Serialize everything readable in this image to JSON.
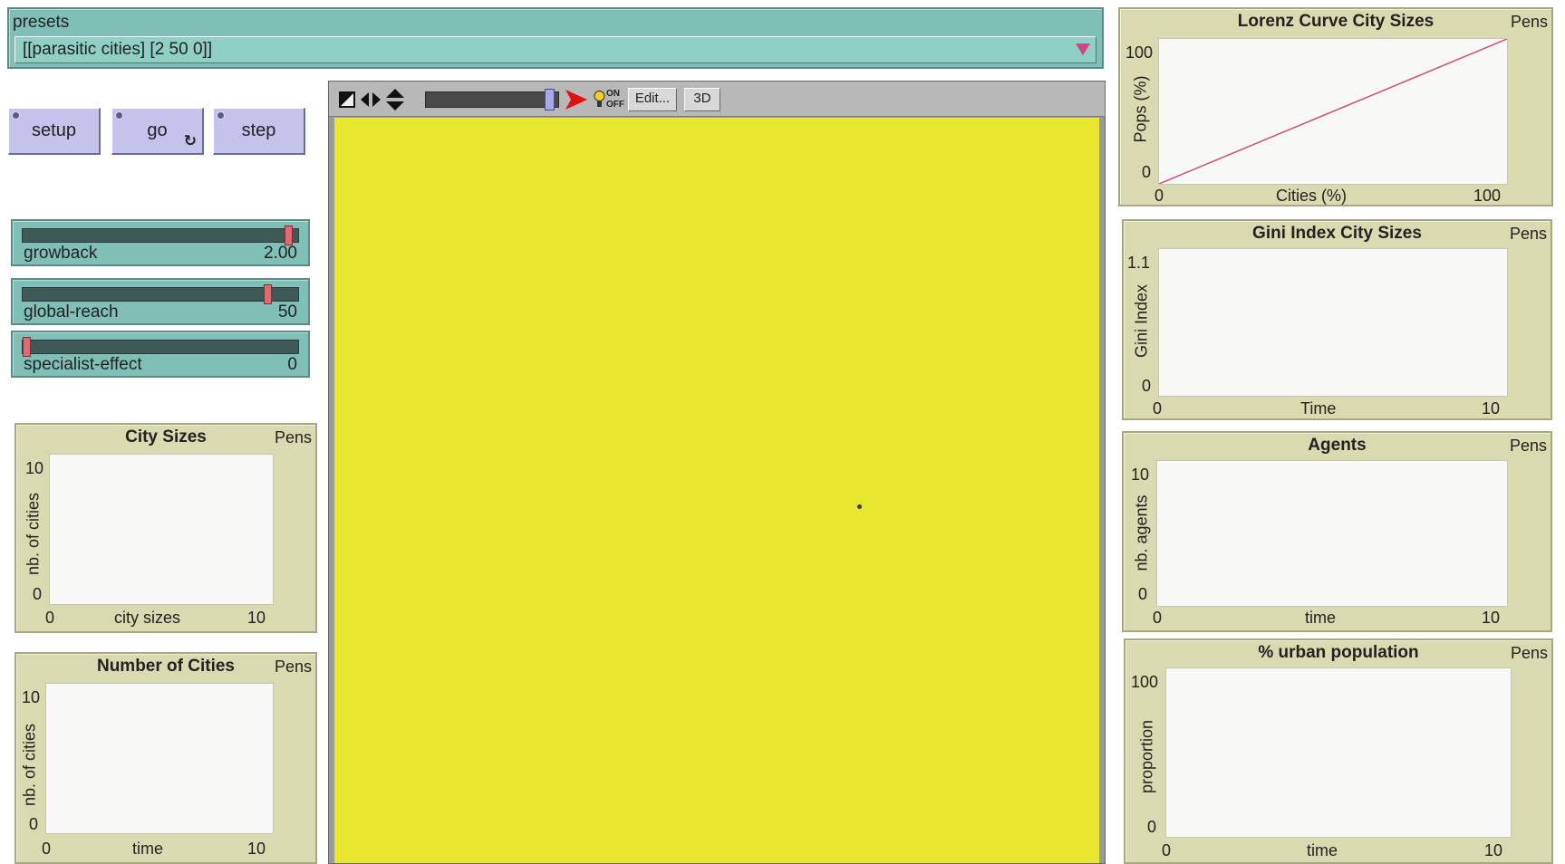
{
  "presets": {
    "label": "presets",
    "selected": "[[parasitic cities] [2 50 0]]"
  },
  "buttons": {
    "setup": "setup",
    "go": "go",
    "step": "step",
    "forever_icon": "forever-icon"
  },
  "sliders": [
    {
      "name": "growback",
      "value": "2.00",
      "level": 0.98
    },
    {
      "name": "global-reach",
      "value": "50",
      "level": 0.9
    },
    {
      "name": "specialist-effect",
      "value": "0",
      "level": 0.0
    }
  ],
  "view_toolbar": {
    "edit_label": "Edit...",
    "three_d_label": "3D",
    "speed_level": 0.97,
    "icons": [
      "size-icon",
      "horizontal-arrows-icon",
      "vertical-arrows-icon",
      "speed-slider",
      "play-arrow-icon",
      "view-updates-toggle-icon"
    ],
    "toggle_on": "ON",
    "toggle_off": "OFF"
  },
  "world": {
    "background": "#e8e62e",
    "agent_color": "#3a3a1a"
  },
  "plots": {
    "city_sizes": {
      "title": "City Sizes",
      "pens": "Pens",
      "xlabel": "city sizes",
      "ylabel": "nb. of cities",
      "xmin": "0",
      "xmax": "10",
      "ymin": "0",
      "ymax": "10"
    },
    "number_of_cities": {
      "title": "Number of Cities",
      "pens": "Pens",
      "xlabel": "time",
      "ylabel": "nb. of cities",
      "xmin": "0",
      "xmax": "10",
      "ymin": "0",
      "ymax": "10"
    },
    "lorenz": {
      "title": "Lorenz Curve City Sizes",
      "pens": "Pens",
      "xlabel": "Cities (%)",
      "ylabel": "Pops (%)",
      "xmin": "0",
      "xmax": "100",
      "ymin": "0",
      "ymax": "100"
    },
    "gini": {
      "title": "Gini Index City Sizes",
      "pens": "Pens",
      "xlabel": "Time",
      "ylabel": "Gini Index",
      "xmin": "0",
      "xmax": "10",
      "ymin": "0",
      "ymax": "1.1"
    },
    "agents": {
      "title": "Agents",
      "pens": "Pens",
      "xlabel": "time",
      "ylabel": "nb. agents",
      "xmin": "0",
      "xmax": "10",
      "ymin": "0",
      "ymax": "10"
    },
    "urban": {
      "title": "% urban population",
      "pens": "Pens",
      "xlabel": "time",
      "ylabel": "proportion",
      "xmin": "0",
      "xmax": "10",
      "ymin": "0",
      "ymax": "100"
    }
  },
  "chart_data": [
    {
      "type": "line",
      "title": "Lorenz Curve City Sizes",
      "xlabel": "Cities (%)",
      "ylabel": "Pops (%)",
      "xlim": [
        0,
        100
      ],
      "ylim": [
        0,
        100
      ],
      "series": [
        {
          "values": [
            {
              "x": 0,
              "y": 0
            },
            {
              "x": 100,
              "y": 100
            }
          ],
          "color": "#d14a7a"
        }
      ]
    }
  ]
}
